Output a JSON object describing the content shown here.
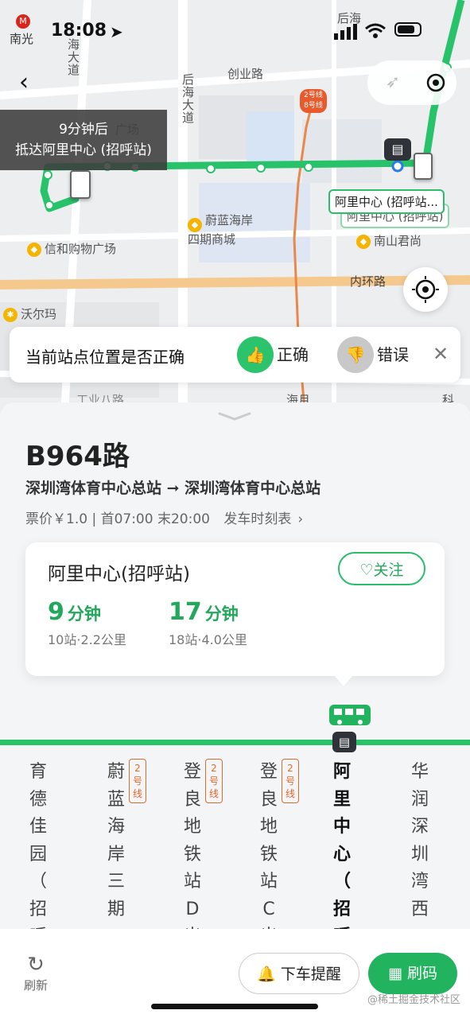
{
  "status_bar": {
    "time": "18:08",
    "metro_station": "南光"
  },
  "map": {
    "labels": {
      "houhai": "后海",
      "chuangye_rd": "创业路",
      "houhai_ave": "后海大道",
      "haihai_ave": "海大道",
      "guangchang": "广场",
      "weilan": "蔚蓝海岸\n四期商城",
      "xinhe": "信和购物广场",
      "nanshan": "南山君尚",
      "neihuan": "内环路",
      "walmart": "沃尔玛",
      "gongye": "工业八路",
      "haiyue": "海月",
      "ke": "科"
    },
    "metro_badge": {
      "line1": "2号线",
      "line2": "8号线"
    },
    "arrival_popup": {
      "line1": "9分钟后",
      "line2": "抵达阿里中心 (招呼站)"
    },
    "stop_tag1": "阿里中心 (招呼站...",
    "stop_tag2": "阿里中心 (招呼站)"
  },
  "feedback": {
    "question": "当前站点位置是否正确",
    "correct": "正确",
    "wrong": "错误"
  },
  "route": {
    "name": "B964路",
    "direction": "深圳湾体育中心总站 ➞ 深圳湾体育中心总站",
    "fare": "票价￥1.0 | 首07:00 末20:00",
    "timetable": "发车时刻表"
  },
  "card": {
    "stop_name": "阿里中心(招呼站)",
    "follow": "关注",
    "eta1": {
      "value": "9",
      "unit": "分钟",
      "sub": "10站·2.2公里"
    },
    "eta2": {
      "value": "17",
      "unit": "分钟",
      "sub": "18站·4.0公里"
    }
  },
  "stations": [
    {
      "name": "育德佳园（招呼",
      "metro": ""
    },
    {
      "name": "蔚蓝海岸三期",
      "metro": "2号线"
    },
    {
      "name": "登良地铁站D出",
      "metro": "2号线"
    },
    {
      "name": "登良地铁站C出",
      "metro": "2号线"
    },
    {
      "name": "阿里中心（招呼",
      "metro": ""
    },
    {
      "name": "华润深圳湾西",
      "metro": ""
    }
  ],
  "bottom": {
    "refresh": "刷新",
    "alight": "下车提醒",
    "scan": "刷码"
  },
  "watermark": "@稀土掘金技术社区",
  "colors": {
    "accent": "#22b35f",
    "route_line": "#27c26a",
    "metro": "#e06a2b"
  }
}
